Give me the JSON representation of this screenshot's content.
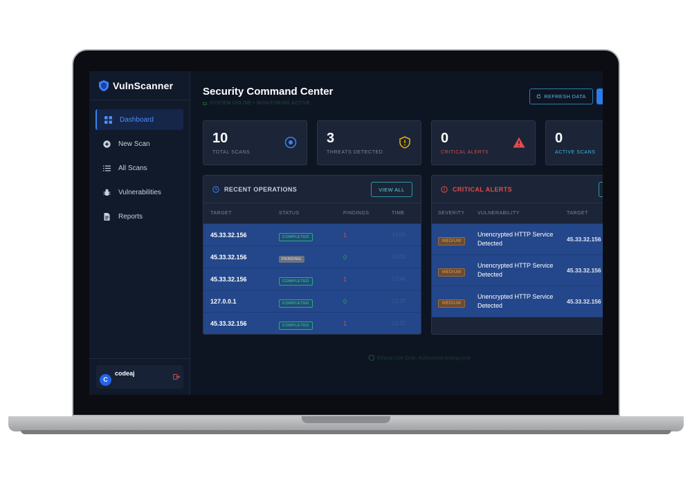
{
  "app": {
    "name": "VulnScanner"
  },
  "sidebar": {
    "items": [
      {
        "label": "Dashboard",
        "icon": "grid-icon",
        "active": true
      },
      {
        "label": "New Scan",
        "icon": "plus-circle-icon",
        "active": false
      },
      {
        "label": "All Scans",
        "icon": "list-icon",
        "active": false
      },
      {
        "label": "Vulnerabilities",
        "icon": "bug-icon",
        "active": false
      },
      {
        "label": "Reports",
        "icon": "file-icon",
        "active": false
      }
    ],
    "user": {
      "initial": "C",
      "name": "codeaj"
    }
  },
  "header": {
    "title": "Security Command Center",
    "status": "SYSTEM ONLINE • MONITORING ACTIVE",
    "refresh_label": "REFRESH DATA"
  },
  "stats": [
    {
      "value": "10",
      "label": "TOTAL SCANS"
    },
    {
      "value": "3",
      "label": "THREATS DETECTED"
    },
    {
      "value": "0",
      "label": "CRITICAL ALERTS"
    },
    {
      "value": "0",
      "label": "ACTIVE SCANS"
    }
  ],
  "recent_operations": {
    "title": "RECENT OPERATIONS",
    "view_all_label": "VIEW ALL",
    "columns": [
      "TARGET",
      "STATUS",
      "FINDINGS",
      "TIME"
    ],
    "rows": [
      {
        "target": "45.33.32.156",
        "status": "COMPLETED",
        "findings": "1",
        "time": "14:06"
      },
      {
        "target": "45.33.32.156",
        "status": "PENDING",
        "findings": "0",
        "time": "14:03"
      },
      {
        "target": "45.33.32.156",
        "status": "COMPLETED",
        "findings": "1",
        "time": "13:48"
      },
      {
        "target": "127.0.0.1",
        "status": "COMPLETED",
        "findings": "0",
        "time": "13:25"
      },
      {
        "target": "45.33.32.156",
        "status": "COMPLETED",
        "findings": "1",
        "time": "13:20"
      }
    ]
  },
  "critical_alerts": {
    "title": "CRITICAL ALERTS",
    "columns": [
      "SEVERITY",
      "VULNERABILITY",
      "TARGET"
    ],
    "rows": [
      {
        "severity": "MEDIUM",
        "vulnerability": "Unencrypted HTTP Service Detected",
        "target": "45.33.32.156"
      },
      {
        "severity": "MEDIUM",
        "vulnerability": "Unencrypted HTTP Service Detected",
        "target": "45.33.32.156"
      },
      {
        "severity": "MEDIUM",
        "vulnerability": "Unencrypted HTTP Service Detected",
        "target": "45.33.32.156"
      }
    ]
  },
  "footer": {
    "note": "Ethical Use Only: Authorized testing only"
  },
  "colors": {
    "accent": "#3b82f6",
    "danger": "#e24c4c",
    "success": "#22a860",
    "warning": "#f3a545"
  }
}
